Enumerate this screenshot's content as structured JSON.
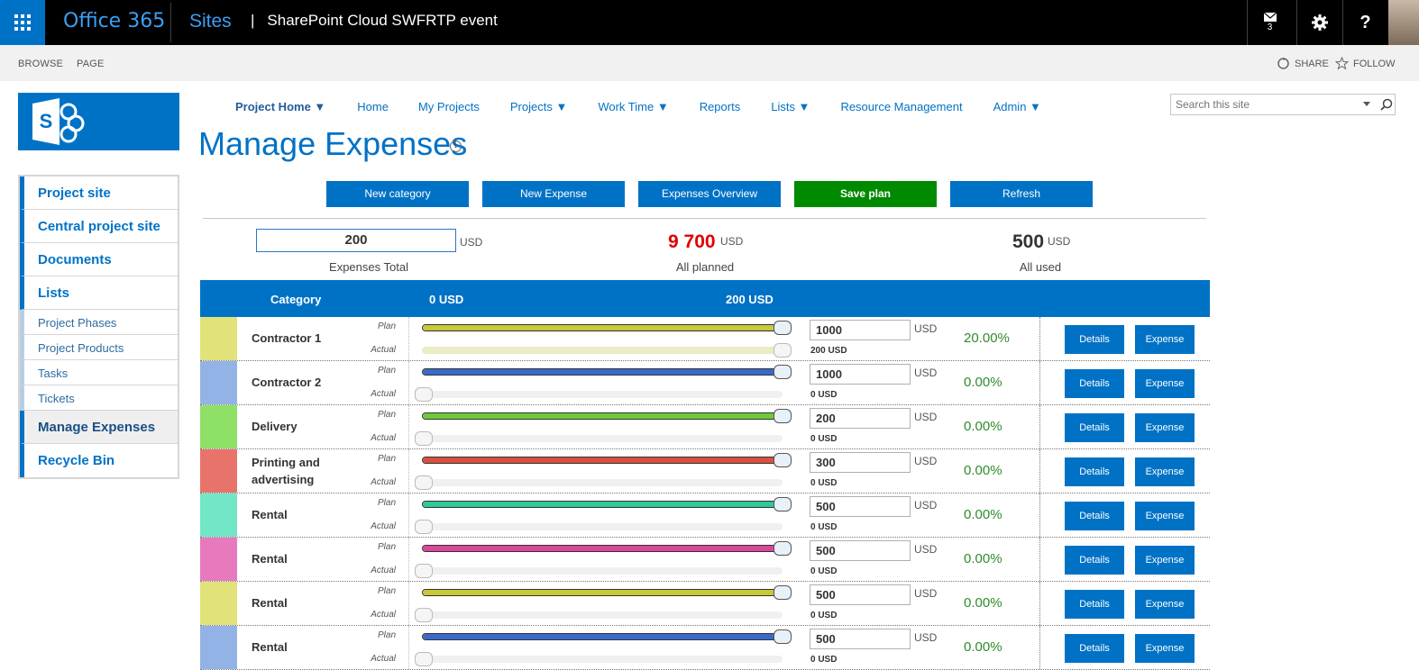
{
  "suitebar": {
    "app_name": "Office 365",
    "section": "Sites",
    "site_title": "SharePoint Cloud SWFRTP event",
    "mail_count": "3",
    "help": "?"
  },
  "ribbon": {
    "tabs": [
      "BROWSE",
      "PAGE"
    ],
    "share": "SHARE",
    "follow": "FOLLOW"
  },
  "topnav": {
    "items": [
      {
        "label": "Project Home ▼"
      },
      {
        "label": "Home"
      },
      {
        "label": "My Projects"
      },
      {
        "label": "Projects ▼"
      },
      {
        "label": "Work Time ▼"
      },
      {
        "label": "Reports"
      },
      {
        "label": "Lists ▼"
      },
      {
        "label": "Resource Management"
      },
      {
        "label": "Admin ▼"
      }
    ]
  },
  "search": {
    "placeholder": "Search this site"
  },
  "page": {
    "title": "Manage Expenses",
    "info": "i"
  },
  "leftnav": {
    "items": [
      {
        "label": "Project site"
      },
      {
        "label": "Central project site"
      },
      {
        "label": "Documents"
      },
      {
        "label": "Lists"
      },
      {
        "label": "Project Phases"
      },
      {
        "label": "Project Products"
      },
      {
        "label": "Tasks"
      },
      {
        "label": "Tickets"
      },
      {
        "label": "Manage Expenses"
      },
      {
        "label": "Recycle Bin"
      }
    ]
  },
  "actions": {
    "new_category": "New category",
    "new_expense": "New Expense",
    "overview": "Expenses Overview",
    "save_plan": "Save plan",
    "refresh": "Refresh"
  },
  "summary": {
    "total_value": "200",
    "currency": "USD",
    "total_label": "Expenses Total",
    "planned_value": "9 700",
    "planned_label": "All planned",
    "used_value": "500",
    "used_label": "All used"
  },
  "table": {
    "col_category": "Category",
    "col_min": "0 USD",
    "col_max": "200  USD",
    "plan_label": "Plan",
    "actual_label": "Actual",
    "details_label": "Details",
    "expense_label": "Expense",
    "rows": [
      {
        "category": "Contractor 1",
        "color": "#e2e27a",
        "bar_color": "#c8c83a",
        "plan": "1000",
        "currency": "USD",
        "actual": "200 USD",
        "percent": "20.00%",
        "plan_level": 1.0,
        "actual_level": 1.0
      },
      {
        "category": "Contractor 2",
        "color": "#93b3e6",
        "bar_color": "#3a6ac8",
        "plan": "1000",
        "currency": "USD",
        "actual": "0 USD",
        "percent": "0.00%",
        "plan_level": 1.0,
        "actual_level": 0.0
      },
      {
        "category": "Delivery",
        "color": "#8ee067",
        "bar_color": "#6ccb3a",
        "plan": "200",
        "currency": "USD",
        "actual": "0 USD",
        "percent": "0.00%",
        "plan_level": 1.0,
        "actual_level": 0.0
      },
      {
        "category": "Printing and advertising",
        "color": "#e8736a",
        "bar_color": "#d9503f",
        "plan": "300",
        "currency": "USD",
        "actual": "0 USD",
        "percent": "0.00%",
        "plan_level": 1.0,
        "actual_level": 0.0
      },
      {
        "category": "Rental",
        "color": "#72e6c6",
        "bar_color": "#2fc99a",
        "plan": "500",
        "currency": "USD",
        "actual": "0 USD",
        "percent": "0.00%",
        "plan_level": 1.0,
        "actual_level": 0.0
      },
      {
        "category": "Rental",
        "color": "#e67abc",
        "bar_color": "#d9479d",
        "plan": "500",
        "currency": "USD",
        "actual": "0 USD",
        "percent": "0.00%",
        "plan_level": 1.0,
        "actual_level": 0.0
      },
      {
        "category": "Rental",
        "color": "#e2e27a",
        "bar_color": "#c8c83a",
        "plan": "500",
        "currency": "USD",
        "actual": "0 USD",
        "percent": "0.00%",
        "plan_level": 1.0,
        "actual_level": 0.0
      },
      {
        "category": "Rental",
        "color": "#93b3e6",
        "bar_color": "#3a6ac8",
        "plan": "500",
        "currency": "USD",
        "actual": "0 USD",
        "percent": "0.00%",
        "plan_level": 1.0,
        "actual_level": 0.0
      }
    ]
  },
  "colors": {
    "brand": "#0072c6",
    "save": "#008a00",
    "planned_total": "#e00000",
    "percent": "#2e8b2e"
  }
}
